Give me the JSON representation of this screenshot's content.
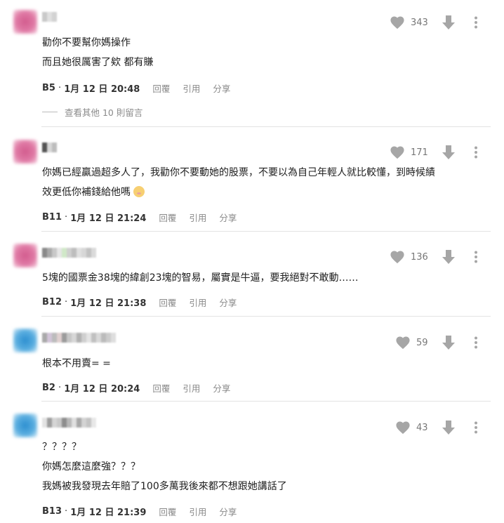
{
  "comments": [
    {
      "floor": "B5",
      "date": "1月 12 日 20:48",
      "likes": "343",
      "lines": [
        "勸你不要幫你媽操作",
        "而且她很厲害了欸 都有賺"
      ],
      "replies_label": "查看其他 10 則留言",
      "avatar_color": "pink"
    },
    {
      "floor": "B11",
      "date": "1月 12 日 21:24",
      "likes": "171",
      "lines": [
        "你媽已經贏過超多人了，我勸你不要動她的股票，不要以為自己年輕人就比較懂，到時候績",
        "效更低你補錢給他嗎"
      ],
      "avatar_color": "pink"
    },
    {
      "floor": "B12",
      "date": "1月 12 日 21:38",
      "likes": "136",
      "lines": [
        "5塊的國票金38塊的緯創23塊的智易，屬實是牛逼，要我絕對不敢動……"
      ],
      "avatar_color": "pink"
    },
    {
      "floor": "B2",
      "date": "1月 12 日 20:24",
      "likes": "59",
      "lines": [
        "根本不用賣= ="
      ],
      "avatar_color": "blue"
    },
    {
      "floor": "B13",
      "date": "1月 12 日 21:39",
      "likes": "43",
      "lines": [
        "？？？？",
        "你媽怎麼這麼強？？？",
        "我媽被我發現去年賠了100多萬我後來都不想跟她講話了"
      ],
      "avatar_color": "blue"
    }
  ],
  "actions": {
    "reply": "回覆",
    "quote": "引用",
    "share": "分享"
  },
  "colors": {
    "icon_gray": "#a6a6a6",
    "meta_gray": "#8a8a8a",
    "divider": "#e3e3e3"
  },
  "icons": [
    "heart-icon",
    "downvote-arrow-icon",
    "more-vert-icon",
    "blushing-emoji-icon"
  ]
}
